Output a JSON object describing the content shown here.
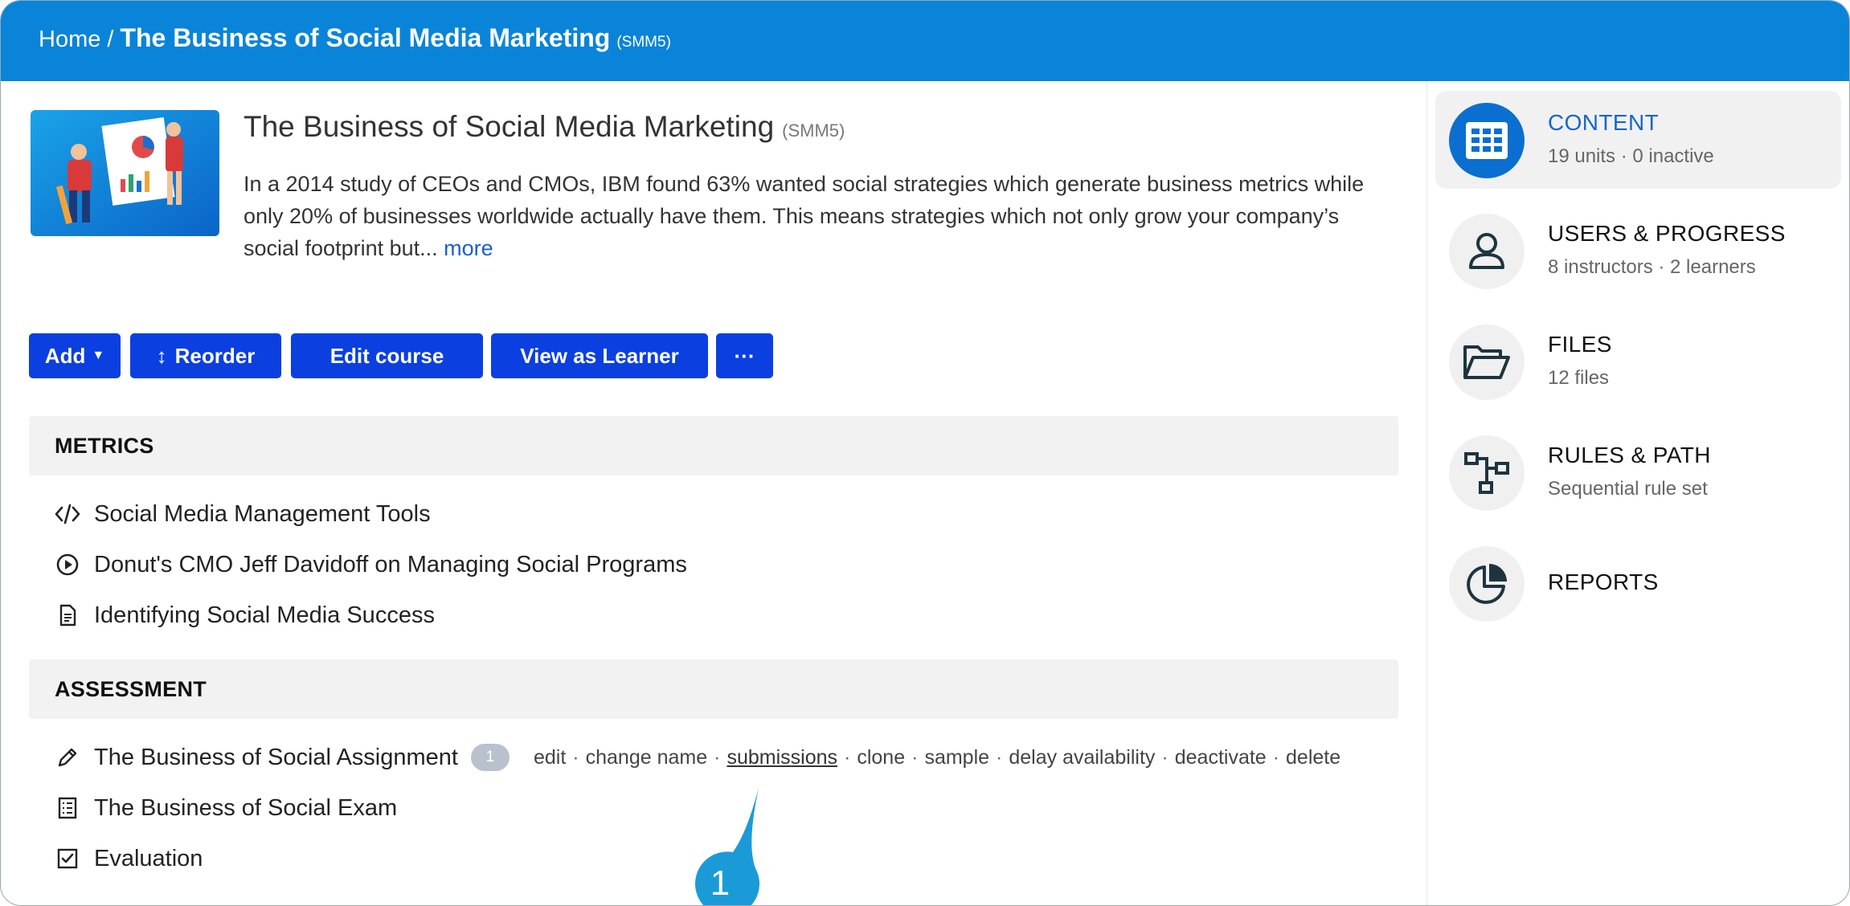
{
  "breadcrumb": {
    "home": "Home",
    "separator": "/",
    "title": "The Business of Social Media Marketing",
    "code": "(SMM5)"
  },
  "course": {
    "title": "The Business of Social Media Marketing",
    "code": "(SMM5)",
    "description": "In a 2014 study of CEOs and CMOs, IBM found 63% wanted social strategies which generate business metrics while only 20% of businesses worldwide actually have them. This means strategies which not only grow your company’s social footprint but...",
    "more_link": "more"
  },
  "toolbar": {
    "add_label": "Add",
    "reorder_label": "Reorder",
    "edit_course_label": "Edit course",
    "view_as_learner_label": "View as Learner",
    "more_label": "···"
  },
  "sections": [
    {
      "heading": "METRICS",
      "items": [
        {
          "label": "Social Media Management Tools",
          "icon": "code-icon"
        },
        {
          "label": "Donut's CMO Jeff Davidoff on Managing Social Programs",
          "icon": "play-circle-icon"
        },
        {
          "label": "Identifying Social Media Success",
          "icon": "document-icon"
        }
      ]
    },
    {
      "heading": "ASSESSMENT",
      "items": [
        {
          "label": "The Business of Social Assignment",
          "icon": "pencil-icon",
          "badge": "1"
        },
        {
          "label": "The Business of Social Exam",
          "icon": "checklist-icon"
        },
        {
          "label": "Evaluation",
          "icon": "checkbox-icon"
        }
      ]
    }
  ],
  "item_actions": [
    "edit",
    "change name",
    "submissions",
    "clone",
    "sample",
    "delay availability",
    "deactivate",
    "delete"
  ],
  "callout": {
    "number": "1"
  },
  "sidebar": {
    "items": [
      {
        "title": "CONTENT",
        "subtitle": "19 units · 0 inactive",
        "icon": "grid-icon",
        "active": true
      },
      {
        "title": "USERS & PROGRESS",
        "subtitle": "8 instructors · 2 learners",
        "icon": "user-icon"
      },
      {
        "title": "FILES",
        "subtitle": "12 files",
        "icon": "folder-icon"
      },
      {
        "title": "RULES & PATH",
        "subtitle": "Sequential rule set",
        "icon": "path-icon"
      },
      {
        "title": "REPORTS",
        "subtitle": "",
        "icon": "pie-chart-icon"
      }
    ]
  },
  "colors": {
    "topbar": "#0a84d8",
    "button": "#0b3fe0",
    "accent": "#1766c7",
    "callout": "#1a9bd7"
  }
}
